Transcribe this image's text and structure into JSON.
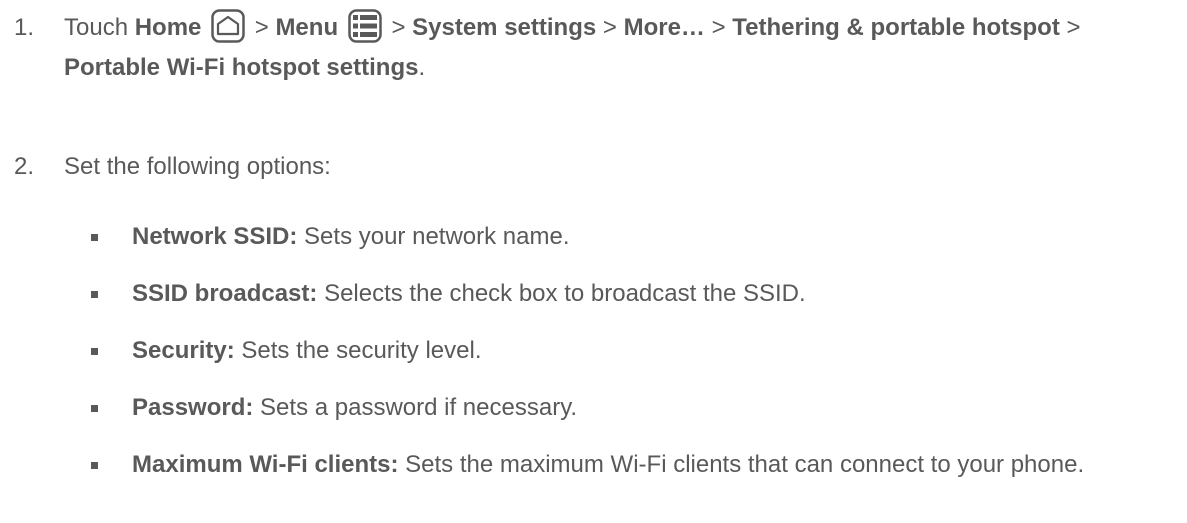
{
  "steps": [
    {
      "number": "1.",
      "touch": "Touch",
      "home": "Home",
      "home_icon": "home-icon",
      "sep1": ">",
      "menu": "Menu",
      "menu_icon": "menu-icon",
      "sep2": ">",
      "system_settings": "System settings",
      "sep3": ">",
      "more": "More…",
      "sep4": ">",
      "tethering": "Tethering & portable hotspot",
      "sep5": ">",
      "hotspot_settings": "Portable Wi-Fi hotspot settings",
      "end": "."
    },
    {
      "number": "2.",
      "text": "Set the following options:"
    }
  ],
  "options": [
    {
      "term": "Network SSID:",
      "desc": "Sets your network name."
    },
    {
      "term": "SSID broadcast:",
      "desc": "Selects the check box to broadcast the SSID."
    },
    {
      "term": "Security:",
      "desc": "Sets the security level."
    },
    {
      "term": "Password:",
      "desc": "Sets a password if necessary."
    },
    {
      "term": "Maximum Wi-Fi clients:",
      "desc": "Sets the maximum Wi-Fi clients that can connect to your phone."
    }
  ],
  "colors": {
    "text": "#595959",
    "icon": "#595959"
  }
}
